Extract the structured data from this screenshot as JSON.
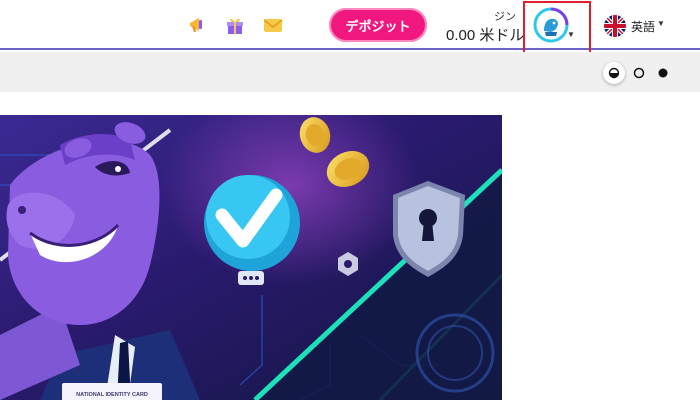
{
  "header": {
    "icons": [
      "megaphone-icon",
      "gift-icon",
      "mail-icon"
    ],
    "deposit_label": "デポジット",
    "balance_label": "ジン",
    "balance_value": "0.00 米ドル",
    "language_label": "英語",
    "colors": {
      "accent": "#6c63c9",
      "deposit": "#f0177e",
      "highlight": "#e01f2d"
    }
  },
  "theme_switcher": {
    "options": [
      "auto-theme-icon",
      "light-theme-icon",
      "dark-theme-icon"
    ],
    "selected": "auto-theme-icon"
  },
  "banner": {
    "card_text": "NATIONAL IDENTITY CARD",
    "colors": {
      "background": "#2a1a6e",
      "neon_line": "#1de2b7",
      "shield": "#9ea7c5"
    }
  }
}
